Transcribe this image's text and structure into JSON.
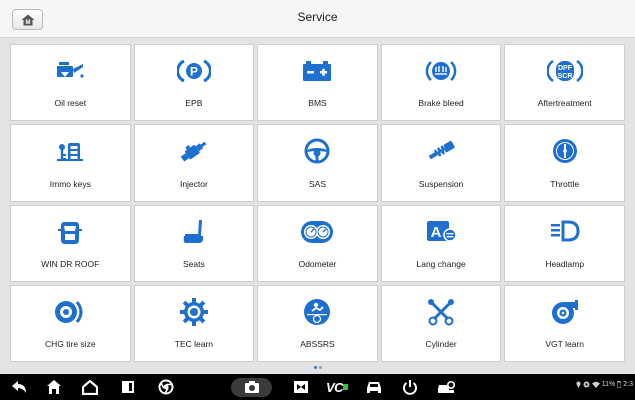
{
  "header": {
    "title": "Service",
    "home_icon": "home-m-icon"
  },
  "accent_color": "#1f6fd1",
  "tiles": [
    {
      "label": "Oil reset",
      "icon": "oil-can-icon"
    },
    {
      "label": "EPB",
      "icon": "parking-brake-icon"
    },
    {
      "label": "BMS",
      "icon": "battery-icon"
    },
    {
      "label": "Brake bleed",
      "icon": "brake-bleed-icon"
    },
    {
      "label": "Aftertreatment",
      "icon": "dpf-scr-icon",
      "badge_top": "DPF",
      "badge_bottom": "SCR"
    },
    {
      "label": "Immo keys",
      "icon": "immo-key-icon"
    },
    {
      "label": "Injector",
      "icon": "injector-icon"
    },
    {
      "label": "SAS",
      "icon": "steering-wheel-icon"
    },
    {
      "label": "Suspension",
      "icon": "suspension-icon"
    },
    {
      "label": "Throttle",
      "icon": "throttle-icon"
    },
    {
      "label": "WIN DR ROOF",
      "icon": "car-window-icon"
    },
    {
      "label": "Seats",
      "icon": "seat-icon"
    },
    {
      "label": "Odometer",
      "icon": "odometer-icon"
    },
    {
      "label": "Lang change",
      "icon": "language-change-icon",
      "badge": "A"
    },
    {
      "label": "Headlamp",
      "icon": "headlamp-icon"
    },
    {
      "label": "CHG tire size",
      "icon": "tire-size-icon"
    },
    {
      "label": "TEC learn",
      "icon": "tec-learn-icon"
    },
    {
      "label": "ABSSRS",
      "icon": "abs-srs-icon"
    },
    {
      "label": "Cylinder",
      "icon": "cylinder-icon"
    },
    {
      "label": "VGT learn",
      "icon": "turbo-icon"
    }
  ],
  "pager": {
    "pages": 2,
    "current": 1
  },
  "navbar": {
    "items": [
      "back-icon",
      "home-icon",
      "house-icon",
      "recent-apps-icon",
      "chrome-icon",
      "camera-icon",
      "screen-capture-icon",
      "vci-icon",
      "car-icon",
      "power-icon",
      "car-settings-icon"
    ],
    "vci_label": "VC",
    "status": {
      "battery": "11%",
      "time": "2:3"
    }
  }
}
